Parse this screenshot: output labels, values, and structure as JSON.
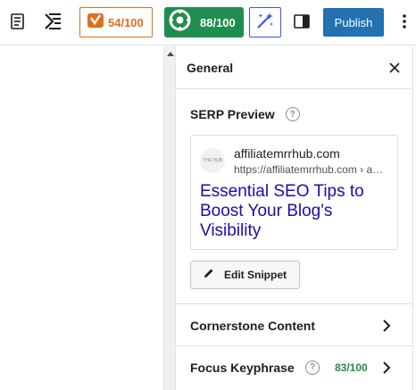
{
  "toolbar": {
    "yoast_score": "54/100",
    "seo_score": "88/100",
    "publish_label": "Publish",
    "icons": [
      "document-overview-icon",
      "document-outline-icon",
      "yoast-icon",
      "rank-math-icon",
      "ai-wand-icon",
      "sidebar-toggle-icon",
      "more-options-icon"
    ],
    "colors": {
      "yoast": "#e06f1d",
      "seo_green": "#1e8e4e",
      "publish": "#2271b1",
      "ai": "#3858e9"
    }
  },
  "sidebar": {
    "title": "General",
    "serp": {
      "heading": "SERP Preview",
      "help": "?",
      "favicon_text": "THE HUB",
      "site_name": "affiliatemrrhub.com",
      "site_url": "https://affiliatemrrhub.com › a…",
      "headline": "Essential SEO Tips to Boost Your Blog's Visibility",
      "headline_color": "#1a0dab"
    },
    "edit_snippet_label": "Edit Snippet",
    "rows": [
      {
        "label": "Cornerstone Content"
      },
      {
        "label": "Focus Keyphrase",
        "help": "?",
        "score": "83/100"
      }
    ]
  }
}
